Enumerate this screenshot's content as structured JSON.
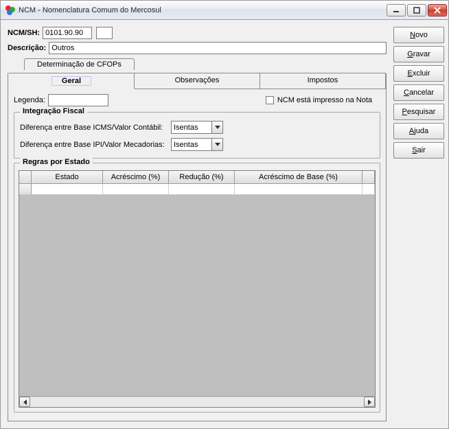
{
  "window": {
    "title": "NCM - Nomenclatura Comum do Mercosul"
  },
  "fields": {
    "ncm_label": "NCM/SH:",
    "ncm_value": "0101.90.90",
    "ncm_suffix": "",
    "desc_label": "Descrição:",
    "desc_value": "Outros"
  },
  "tabs_upper": {
    "determinacao": "Determinação de CFOPs"
  },
  "tabs": {
    "geral": "Geral",
    "observacoes": "Observações",
    "impostos": "Impostos"
  },
  "geral": {
    "legenda_label": "Legenda:",
    "legenda_value": "",
    "checkbox_label": "NCM está impresso na Nota"
  },
  "integracao": {
    "legend": "Integração Fiscal",
    "row1_label": "Diferença entre Base ICMS/Valor Contábil:",
    "row1_value": "Isentas",
    "row2_label": "Diferença entre Base IPI/Valor Mecadorias:",
    "row2_value": "Isentas"
  },
  "regras": {
    "legend": "Regras por Estado",
    "columns": {
      "estado": "Estado",
      "acrescimo": "Acréscimo (%)",
      "reducao": "Redução (%)",
      "acrescimo_base": "Acréscimo de Base (%)"
    }
  },
  "buttons": {
    "novo": {
      "u": "N",
      "rest": "ovo"
    },
    "gravar": {
      "u": "G",
      "rest": "ravar"
    },
    "excluir": {
      "u": "E",
      "rest": "xcluir"
    },
    "cancelar": {
      "u": "C",
      "rest": "ancelar"
    },
    "pesquisar": {
      "u": "P",
      "rest": "esquisar"
    },
    "ajuda": {
      "u": "A",
      "rest": "juda"
    },
    "sair": {
      "u": "S",
      "rest": "air"
    }
  }
}
